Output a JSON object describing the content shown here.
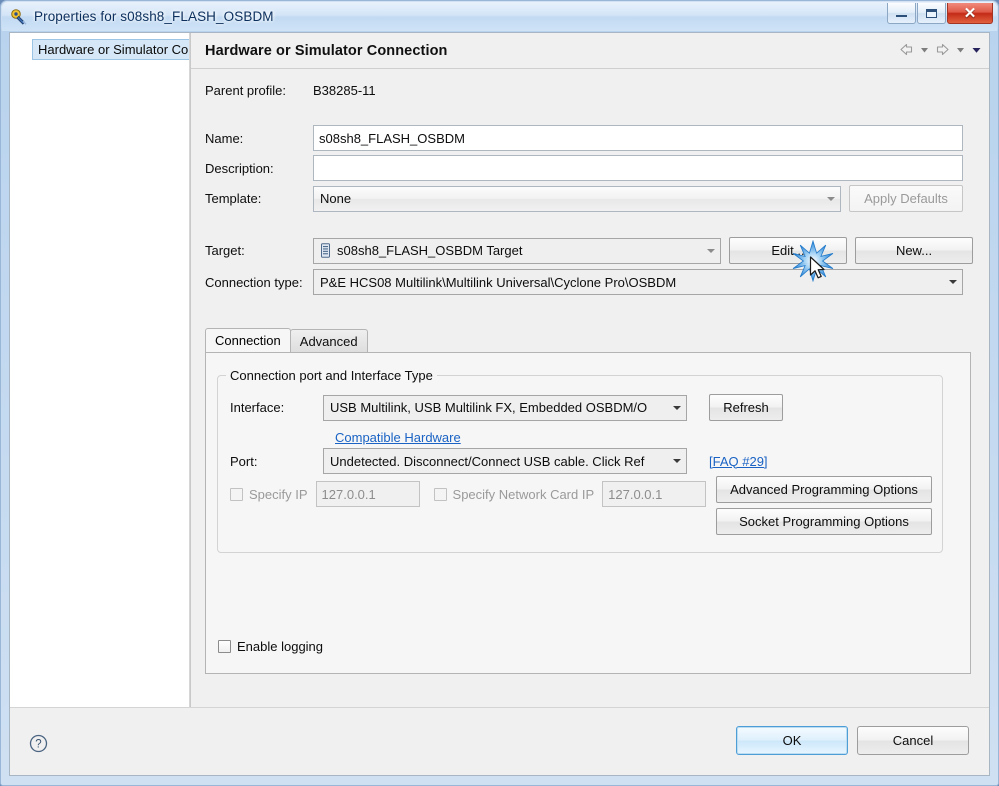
{
  "window": {
    "title": "Properties for s08sh8_FLASH_OSBDM",
    "icon": "properties-icon",
    "controls": {
      "minimize": "minimize-button",
      "restore": "restore-button",
      "close": "✕"
    }
  },
  "sidebar": {
    "items": [
      {
        "label": "Hardware or Simulator Connection",
        "selected": true
      }
    ]
  },
  "page": {
    "title": "Hardware or Simulator Connection",
    "nav": {
      "back": "back-arrow-icon",
      "back_menu": "back-history-dropdown",
      "forward": "forward-arrow-icon",
      "forward_menu": "forward-history-dropdown",
      "view_menu": "view-menu-dropdown"
    },
    "fields": {
      "parent_profile_label": "Parent profile:",
      "parent_profile_value": "B38285-11",
      "name_label": "Name:",
      "name_value": "s08sh8_FLASH_OSBDM",
      "description_label": "Description:",
      "description_value": "",
      "description_placeholder": "",
      "template_label": "Template:",
      "template_value": "None",
      "apply_defaults_label": "Apply Defaults",
      "target_label": "Target:",
      "target_value": "s08sh8_FLASH_OSBDM Target",
      "target_icon": "device-chip-icon",
      "edit_label": "Edit...",
      "new_label": "New...",
      "connection_type_label": "Connection type:",
      "connection_type_value": "P&E HCS08 Multilink\\Multilink Universal\\Cyclone Pro\\OSBDM"
    },
    "tabs": [
      {
        "label": "Connection",
        "active": true
      },
      {
        "label": "Advanced",
        "active": false
      }
    ],
    "group": {
      "title": "Connection port and Interface Type",
      "interface_label": "Interface:",
      "interface_value": "USB Multilink, USB Multilink FX, Embedded OSBDM/O",
      "refresh_label": "Refresh",
      "compatible_hardware_link": "Compatible Hardware",
      "port_label": "Port:",
      "port_value": "Undetected. Disconnect/Connect USB cable. Click Ref",
      "faq_link": "[FAQ #29]",
      "specify_ip_label": "Specify IP",
      "specify_ip_checked": false,
      "specify_ip_value": "127.0.0.1",
      "specify_network_card_ip_label": "Specify Network Card IP",
      "specify_network_card_ip_checked": false,
      "specify_network_card_ip_value": "127.0.0.1",
      "advanced_programming_label": "Advanced Programming Options",
      "socket_programming_label": "Socket Programming Options"
    },
    "enable_logging_label": "Enable logging",
    "enable_logging_checked": false
  },
  "footer": {
    "help_icon": "help-question-icon",
    "ok_label": "OK",
    "cancel_label": "Cancel"
  },
  "pointer": {
    "click_effect": "click-sparkle",
    "cursor": "mouse-cursor-arrow"
  },
  "colors": {
    "accent": "#1a63c4",
    "titlebar": "#c5daf0",
    "selection": "#d6e8f7",
    "close_button": "#c42b18"
  }
}
